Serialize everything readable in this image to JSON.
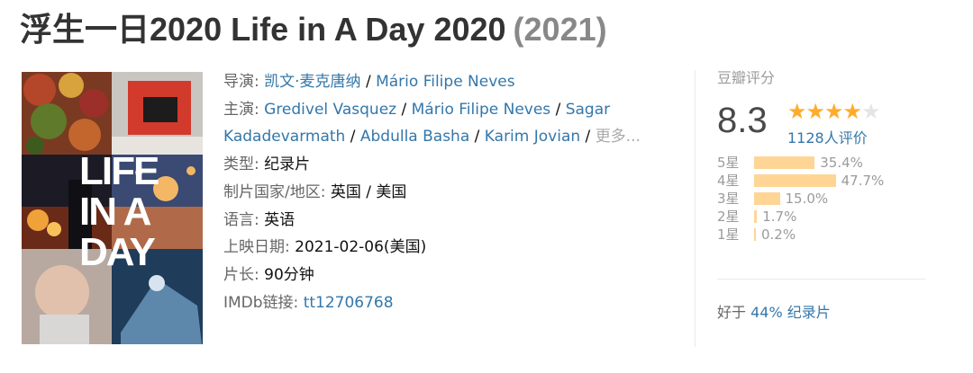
{
  "title": {
    "main": "浮生一日2020 Life in A Day 2020",
    "year": "(2021)"
  },
  "poster": {
    "line1": "LIFE",
    "line2": "IN A",
    "line3": "DAY"
  },
  "info": {
    "director_label": "导演:",
    "directors": [
      "凯文·麦克唐纳",
      "Mário Filipe Neves"
    ],
    "cast_label": "主演:",
    "cast_line1": [
      "Gredivel Vasquez",
      "Mário Filipe Neves",
      "Sagar"
    ],
    "cast_line2": [
      "Kadadevarmath",
      "Abdulla Basha",
      "Karim Jovian"
    ],
    "more": "更多...",
    "separator": " / ",
    "genre_label": "类型:",
    "genre": "纪录片",
    "country_label": "制片国家/地区:",
    "country": "英国 / 美国",
    "language_label": "语言:",
    "language": "英语",
    "release_label": "上映日期:",
    "release": "2021-02-06(美国)",
    "runtime_label": "片长:",
    "runtime": "90分钟",
    "imdb_label": "IMDb链接:",
    "imdb": "tt12706768"
  },
  "rating": {
    "title": "豆瓣评分",
    "score": "8.3",
    "stars_filled": 4,
    "stars_total": 5,
    "votes": "1128人评价",
    "distribution": [
      {
        "label": "5星",
        "pct_text": "35.4%",
        "pct": 35.4
      },
      {
        "label": "4星",
        "pct_text": "47.7%",
        "pct": 47.7
      },
      {
        "label": "3星",
        "pct_text": "15.0%",
        "pct": 15.0
      },
      {
        "label": "2星",
        "pct_text": "1.7%",
        "pct": 1.7
      },
      {
        "label": "1星",
        "pct_text": "0.2%",
        "pct": 0.2
      }
    ],
    "better_prefix": "好于",
    "better_link": "44% 纪录片"
  },
  "colors": {
    "link": "#3377aa",
    "star_on": "#ffac2d",
    "star_off": "#e5e5e5",
    "bar": "#ffd596"
  }
}
